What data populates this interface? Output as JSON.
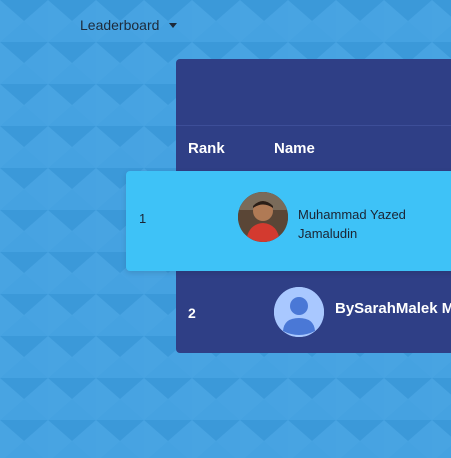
{
  "header": {
    "menu_label": "Leaderboard"
  },
  "table": {
    "columns": {
      "rank": "Rank",
      "name": "Name"
    },
    "rows": [
      {
        "rank": "1",
        "name_line1": "Muhammad Yazed",
        "name_line2": "Jamaludin"
      },
      {
        "rank": "2",
        "name": "BySarahMalek M"
      }
    ]
  },
  "colors": {
    "background": "#3d9ee0",
    "board": "#2f3f86",
    "highlight_row": "#3ec2f7",
    "placeholder_avatar": "#a9c8ff"
  },
  "icons": {
    "dropdown": "caret-down-icon",
    "row2_avatar": "default-user-avatar-icon"
  }
}
